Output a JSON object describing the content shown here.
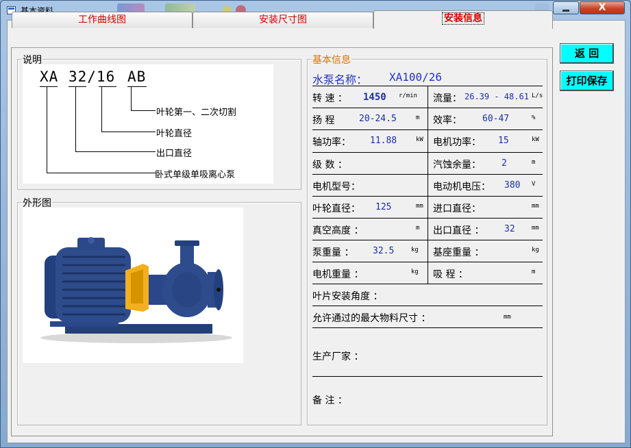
{
  "window": {
    "title": "基本资料",
    "close_glyph": "X"
  },
  "tabs": [
    {
      "label": "工作曲线图"
    },
    {
      "label": "安装尺寸图"
    },
    {
      "label": "安装信息",
      "active": true
    }
  ],
  "description": {
    "caption": "说明",
    "model_code": {
      "part1": "XA",
      "part2": "32/16",
      "part3": "AB"
    },
    "labels": [
      "叶轮第一、二次切割",
      "叶轮直径",
      "出口直径",
      "卧式单级单吸离心泵"
    ]
  },
  "outline": {
    "caption": "外形图",
    "image": "centrifugal-pump-photo"
  },
  "info": {
    "caption": "基本信息",
    "pump_name_label": "水泵名称：",
    "pump_name_value": "XA100/26",
    "rows": [
      {
        "left_label": "转 速 ：",
        "left_value": "1450",
        "left_unit": "r/min",
        "right_label": "流量：",
        "right_value": "26.39 - 48.61",
        "right_unit": "L/s"
      },
      {
        "left_label": "扬 程",
        "left_value": "20-24.5",
        "left_unit": "m",
        "right_label": "效率：",
        "right_value": "60-47",
        "right_unit": "%"
      },
      {
        "left_label": "轴功率：",
        "left_value": "11.88",
        "left_unit": "kW",
        "right_label": "电机功率：",
        "right_value": "15",
        "right_unit": "kW"
      },
      {
        "left_label": "级 数 ：",
        "left_value": "",
        "left_unit": "",
        "right_label": "汽蚀余量：",
        "right_value": "2",
        "right_unit": "m"
      },
      {
        "left_label": "电机型号：",
        "left_value": "",
        "left_unit": "",
        "right_label": "电动机电压：",
        "right_value": "380",
        "right_unit": "V"
      },
      {
        "left_label": "叶轮直径：",
        "left_value": "125",
        "left_unit": "mm",
        "right_label": "进口直径：",
        "right_value": "",
        "right_unit": "mm"
      },
      {
        "left_label": "真空高度 ：",
        "left_value": "",
        "left_unit": "m",
        "right_label": "出口直径 ：",
        "right_value": "32",
        "right_unit": "mm"
      },
      {
        "left_label": "泵重量 ：",
        "left_value": "32.5",
        "left_unit": "kg",
        "right_label": "基座重量 ：",
        "right_value": "",
        "right_unit": "kg"
      },
      {
        "left_label": "电机重量 ：",
        "left_value": "",
        "left_unit": "kg",
        "right_label": "吸 程 ：",
        "right_value": "",
        "right_unit": "m"
      }
    ],
    "blade_angle_label": "叶片安装角度 ：",
    "max_size_label": "允许通过的最大物料尺寸 ：",
    "max_size_unit": "mm",
    "manufacturer_label": "生产厂家 ：",
    "remark_label": "备 注 ："
  },
  "buttons": {
    "back": "返 回",
    "print_save": "打印保存"
  },
  "colors": {
    "tab_text": "#d40000",
    "value_text": "#1a2ea8",
    "info_caption": "#e07000",
    "button_bg": "#00ffff",
    "pump_body": "#2e4c8c",
    "coupling_guard": "#f2b01e"
  }
}
